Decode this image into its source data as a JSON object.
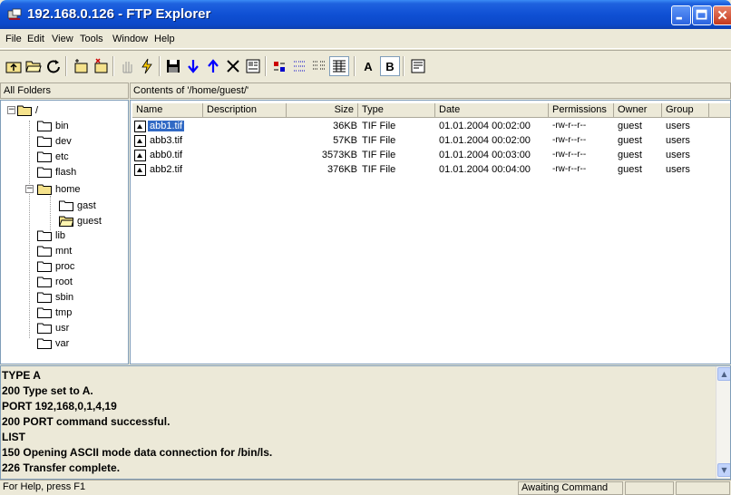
{
  "window": {
    "title": "192.168.0.126 - FTP Explorer"
  },
  "menu": [
    "File",
    "Edit",
    "View",
    "Tools",
    "Window",
    "Help"
  ],
  "toolbar": {
    "mode_a": "A",
    "mode_b": "B"
  },
  "tree_header": "All Folders",
  "content_header": "Contents of '/home/guest/'",
  "tree": {
    "root": "/",
    "items": [
      "bin",
      "dev",
      "etc",
      "flash",
      "home",
      "gast",
      "guest",
      "lib",
      "mnt",
      "proc",
      "root",
      "sbin",
      "tmp",
      "usr",
      "var"
    ]
  },
  "columns": [
    "Name",
    "Description",
    "Size",
    "Type",
    "Date",
    "Permissions",
    "Owner",
    "Group"
  ],
  "files": [
    {
      "name": "abb1.tif",
      "size": "36KB",
      "type": "TIF File",
      "date": "01.01.2004 00:02:00",
      "perms": "-rw-r--r--",
      "owner": "guest",
      "group": "users"
    },
    {
      "name": "abb3.tif",
      "size": "57KB",
      "type": "TIF File",
      "date": "01.01.2004 00:02:00",
      "perms": "-rw-r--r--",
      "owner": "guest",
      "group": "users"
    },
    {
      "name": "abb0.tif",
      "size": "3573KB",
      "type": "TIF File",
      "date": "01.01.2004 00:03:00",
      "perms": "-rw-r--r--",
      "owner": "guest",
      "group": "users"
    },
    {
      "name": "abb2.tif",
      "size": "376KB",
      "type": "TIF File",
      "date": "01.01.2004 00:04:00",
      "perms": "-rw-r--r--",
      "owner": "guest",
      "group": "users"
    }
  ],
  "log": [
    "TYPE A",
    "200 Type set to A.",
    "PORT 192,168,0,1,4,19",
    "200 PORT command successful.",
    "LIST",
    "150 Opening ASCII mode data connection for /bin/ls.",
    "226 Transfer complete."
  ],
  "status": {
    "help": "For Help, press F1",
    "state": "Awaiting Command"
  },
  "colors": {
    "selection": "#316ac5",
    "folder": "#f5e28c",
    "titlebar": "#0b48c8"
  }
}
